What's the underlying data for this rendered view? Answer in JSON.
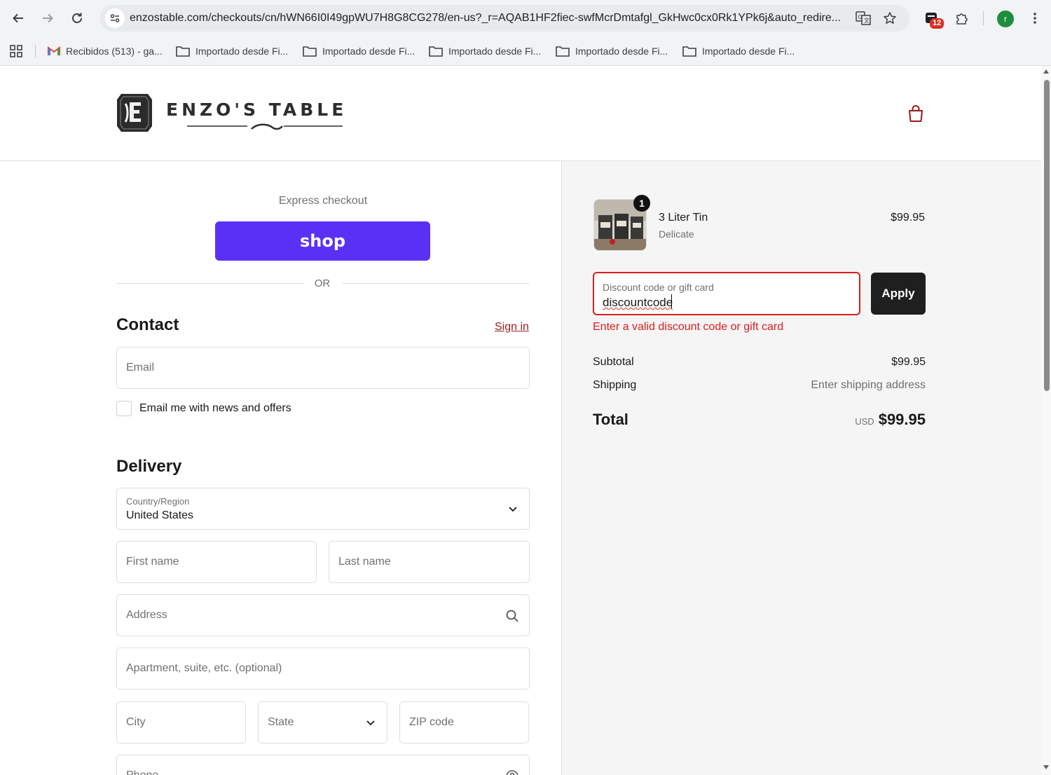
{
  "browser": {
    "url": "enzostable.com/checkouts/cn/hWN66I0I49gpWU7H8G8CG278/en-us?_r=AQAB1HF2fiec-swfMcrDmtafgl_GkHwc0cx0Rk1YPk6j&auto_redire...",
    "extension_badge": "12",
    "avatar_letter": "r",
    "bookmarks": [
      "Recibidos (513) - ga...",
      "Importado desde Fi...",
      "Importado desde Fi...",
      "Importado desde Fi...",
      "Importado desde Fi...",
      "Importado desde Fi..."
    ]
  },
  "brand": {
    "name": "ENZO'S TABLE"
  },
  "express": {
    "label": "Express checkout",
    "shop_button": "shop",
    "divider": "OR"
  },
  "contact": {
    "title": "Contact",
    "sign_in": "Sign in",
    "email_placeholder": "Email",
    "newsletter_label": "Email me with news and offers"
  },
  "delivery": {
    "title": "Delivery",
    "country_label": "Country/Region",
    "country_value": "United States",
    "first_name": "First name",
    "last_name": "Last name",
    "address": "Address",
    "apartment": "Apartment, suite, etc. (optional)",
    "city": "City",
    "state": "State",
    "zip": "ZIP code",
    "phone": "Phone"
  },
  "cart": {
    "quantity": "1",
    "item_name": "3 Liter Tin",
    "item_variant": "Delicate",
    "item_price": "$99.95"
  },
  "discount": {
    "label": "Discount code or gift card",
    "value": "discountcode",
    "apply": "Apply",
    "error": "Enter a valid discount code or gift card"
  },
  "summary": {
    "subtotal_label": "Subtotal",
    "subtotal_value": "$99.95",
    "shipping_label": "Shipping",
    "shipping_value": "Enter shipping address",
    "total_label": "Total",
    "currency": "USD",
    "total_value": "$99.95"
  },
  "colors": {
    "shop_purple": "#5a31f4",
    "accent_red": "#9b1c1c",
    "error_red": "#dd1d1d",
    "dark_button": "#1f1f1f"
  }
}
